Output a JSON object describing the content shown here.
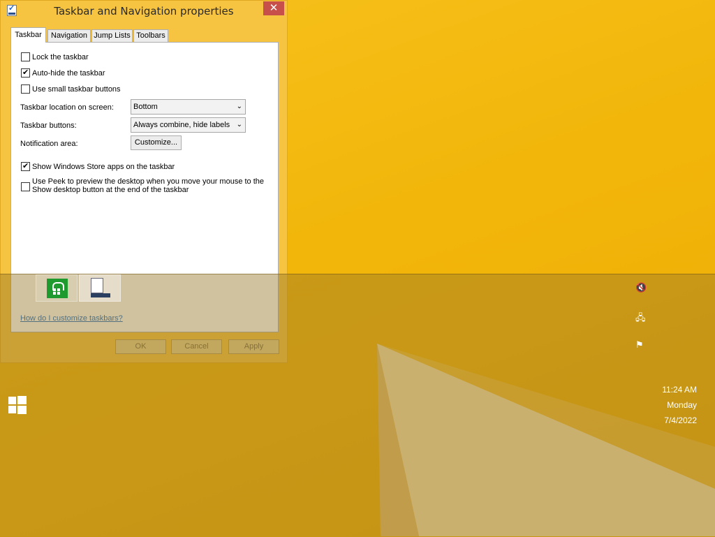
{
  "window": {
    "title": "Taskbar and Navigation properties",
    "close_symbol": "✕"
  },
  "tabs": [
    {
      "label": "Taskbar",
      "active": true
    },
    {
      "label": "Navigation",
      "active": false
    },
    {
      "label": "Jump Lists",
      "active": false
    },
    {
      "label": "Toolbars",
      "active": false
    }
  ],
  "taskbar_tab": {
    "lock_taskbar": {
      "label": "Lock the taskbar",
      "checked": false
    },
    "auto_hide": {
      "label": "Auto-hide the taskbar",
      "checked": true
    },
    "small_buttons": {
      "label": "Use small taskbar buttons",
      "checked": false
    },
    "location_label": "Taskbar location on screen:",
    "location_value": "Bottom",
    "buttons_label": "Taskbar buttons:",
    "buttons_value": "Always combine, hide labels",
    "notification_label": "Notification area:",
    "customize_button": "Customize...",
    "store_apps": {
      "label": "Show Windows Store apps on the taskbar",
      "checked": true
    },
    "peek": {
      "label_line1": "Use Peek to preview the desktop when you move your mouse to the",
      "label_line2": "Show desktop button at the end of the taskbar",
      "checked": false
    },
    "help_link": "How do I customize taskbars?"
  },
  "dialog_buttons": {
    "ok": "OK",
    "cancel": "Cancel",
    "apply": "Apply"
  },
  "taskbar": {
    "pinned": [
      {
        "name": "store-app-icon"
      },
      {
        "name": "taskbar-properties-icon"
      }
    ]
  },
  "tray": {
    "icons": [
      "volume-muted-icon",
      "network-icon",
      "action-center-flag-icon"
    ]
  },
  "clock": {
    "time": "11:24 AM",
    "day": "Monday",
    "date": "7/4/2022"
  },
  "colors": {
    "wallpaper": "#f2b60a",
    "store_green": "#1e9a2e",
    "close_red": "#c7504b",
    "link_blue": "#1b6ac9"
  }
}
